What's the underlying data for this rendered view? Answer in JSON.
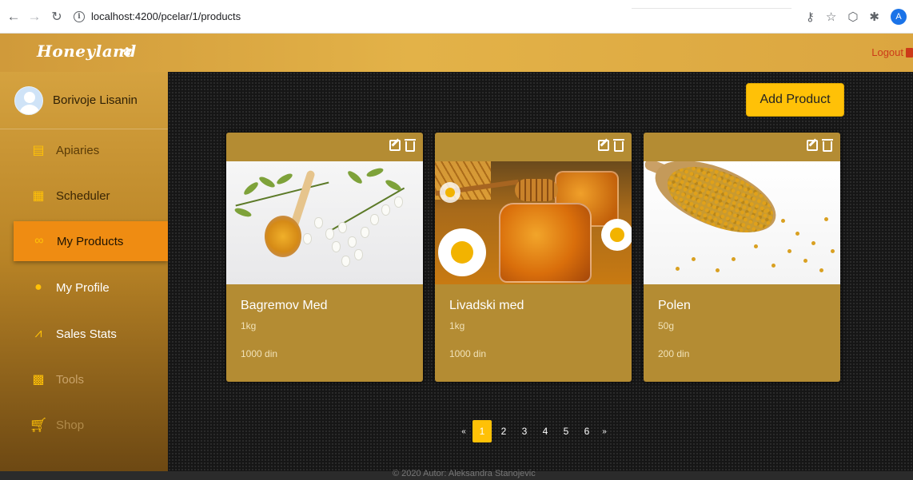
{
  "browser": {
    "url": "localhost:4200/pcelar/1/products",
    "icons": [
      "back-arrow-icon",
      "forward-arrow-icon",
      "reload-icon",
      "info-icon",
      "key-icon",
      "star-icon",
      "extension-icon",
      "puzzle-icon"
    ],
    "profile_initial": "A"
  },
  "header": {
    "logo_text": "Honeyland",
    "logout_label": "Logout"
  },
  "sidebar": {
    "user_name": "Borivoje Lisanin",
    "items": [
      {
        "label": "Apiaries",
        "icon": "apiary-icon",
        "color": "#5a3b07"
      },
      {
        "label": "Scheduler",
        "icon": "calendar-icon",
        "color": "#3b2605"
      },
      {
        "label": "My Products",
        "icon": "products-icon",
        "color": "#1e1302",
        "active": true
      },
      {
        "label": "My Profile",
        "icon": "profile-icon",
        "color": "#ffffff"
      },
      {
        "label": "Sales Stats",
        "icon": "chart-icon",
        "color": "#ffffff"
      },
      {
        "label": "Tools",
        "icon": "calculator-icon",
        "color": "#c9a36a"
      },
      {
        "label": "Shop",
        "icon": "cart-icon",
        "color": "#b08a4a"
      }
    ]
  },
  "main": {
    "add_product_label": "Add Product",
    "products": [
      {
        "name": "Bagremov Med",
        "weight": "1kg",
        "price": "1000 din"
      },
      {
        "name": "Livadski med",
        "weight": "1kg",
        "price": "1000 din"
      },
      {
        "name": "Polen",
        "weight": "50g",
        "price": "200 din"
      }
    ],
    "pagination": {
      "prev": "«",
      "pages": [
        "1",
        "2",
        "3",
        "4",
        "5",
        "6"
      ],
      "current": "1",
      "next": "»"
    }
  },
  "footer": {
    "text": "© 2020 Autor: Aleksandra Stanojevic"
  },
  "colors": {
    "accent": "#ffc107",
    "active_nav": "#ef8c12",
    "card": "#b48c33",
    "logout": "#cc3a18"
  }
}
